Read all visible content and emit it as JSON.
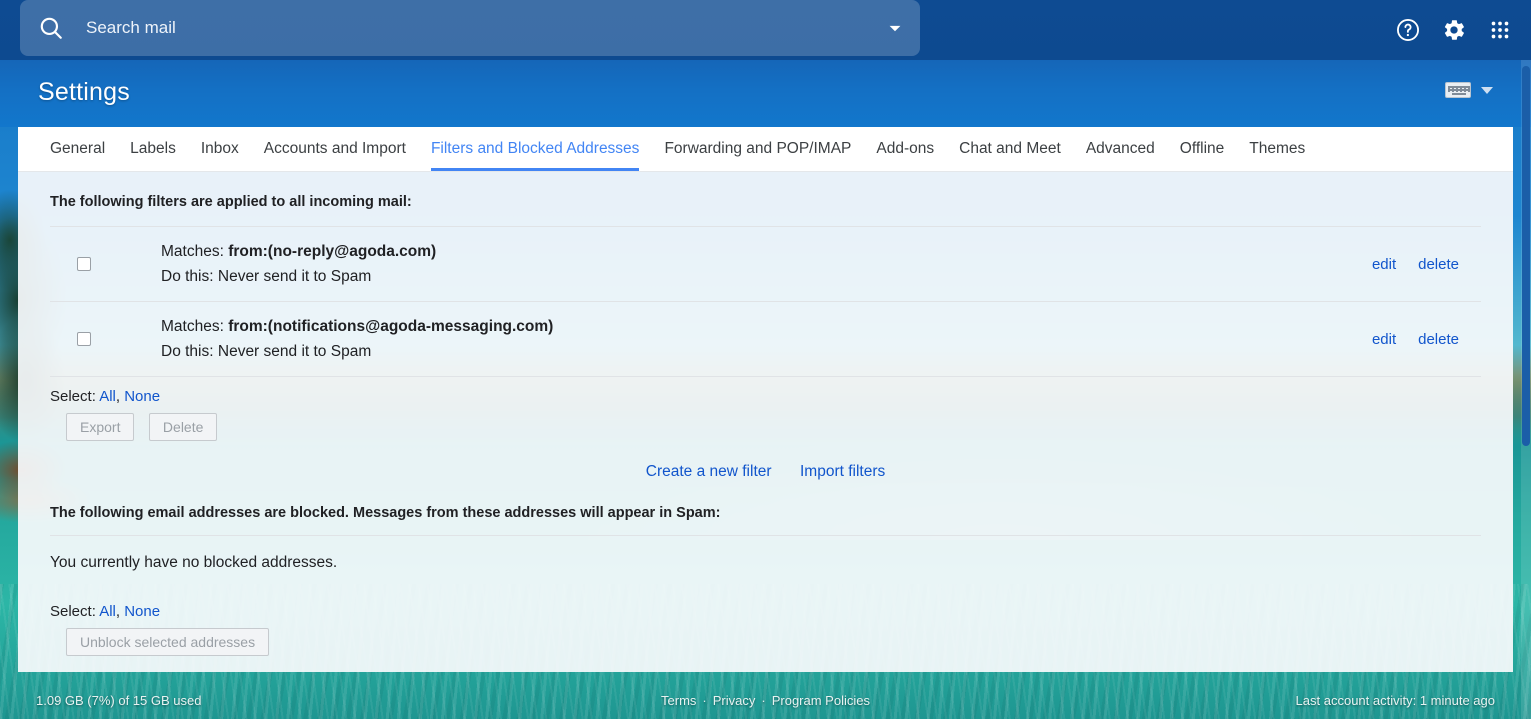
{
  "topbar": {
    "search_placeholder": "Search mail",
    "search_value": "",
    "search_icon": "search-icon",
    "options_icon": "chevron-down-icon",
    "help_icon": "help-icon",
    "settings_icon": "gear-icon",
    "apps_icon": "apps-grid-icon"
  },
  "settings_header": {
    "title": "Settings",
    "input_tools_icon": "keyboard-icon",
    "input_tools_caret": "chevron-down-icon"
  },
  "tabs": [
    {
      "label": "General",
      "active": false
    },
    {
      "label": "Labels",
      "active": false
    },
    {
      "label": "Inbox",
      "active": false
    },
    {
      "label": "Accounts and Import",
      "active": false
    },
    {
      "label": "Filters and Blocked Addresses",
      "active": true
    },
    {
      "label": "Forwarding and POP/IMAP",
      "active": false
    },
    {
      "label": "Add-ons",
      "active": false
    },
    {
      "label": "Chat and Meet",
      "active": false
    },
    {
      "label": "Advanced",
      "active": false
    },
    {
      "label": "Offline",
      "active": false
    },
    {
      "label": "Themes",
      "active": false
    }
  ],
  "filters": {
    "heading": "The following filters are applied to all incoming mail:",
    "rows": [
      {
        "matches_label": "Matches:",
        "criteria": "from:(no-reply@agoda.com)",
        "action_label": "Do this:",
        "action": "Never send it to Spam",
        "edit": "edit",
        "delete": "delete",
        "checked": false
      },
      {
        "matches_label": "Matches:",
        "criteria": "from:(notifications@agoda-messaging.com)",
        "action_label": "Do this:",
        "action": "Never send it to Spam",
        "edit": "edit",
        "delete": "delete",
        "checked": false
      }
    ],
    "select_label": "Select:",
    "select_all": "All",
    "select_sep": ",",
    "select_none": "None",
    "export_button": "Export",
    "delete_button": "Delete",
    "create_filter_link": "Create a new filter",
    "import_filters_link": "Import filters"
  },
  "blocked": {
    "heading": "The following email addresses are blocked. Messages from these addresses will appear in Spam:",
    "empty_message": "You currently have no blocked addresses.",
    "select_label": "Select:",
    "select_all": "All",
    "select_sep": ",",
    "select_none": "None",
    "unblock_button": "Unblock selected addresses"
  },
  "footer": {
    "storage": "1.09 GB (7%) of 15 GB used",
    "terms": "Terms",
    "privacy": "Privacy",
    "program_policies": "Program Policies",
    "sep1": "·",
    "sep2": "·",
    "last_activity": "Last account activity: 1 minute ago"
  },
  "colors": {
    "topbar_blue": "#0d4a90",
    "header_blue": "#1470c4",
    "accent_blue": "#4285f4",
    "link_blue": "#1155cc",
    "panel_bg": "#f8fafc",
    "text_primary": "#202124",
    "disabled_text": "#9aa0a6"
  }
}
